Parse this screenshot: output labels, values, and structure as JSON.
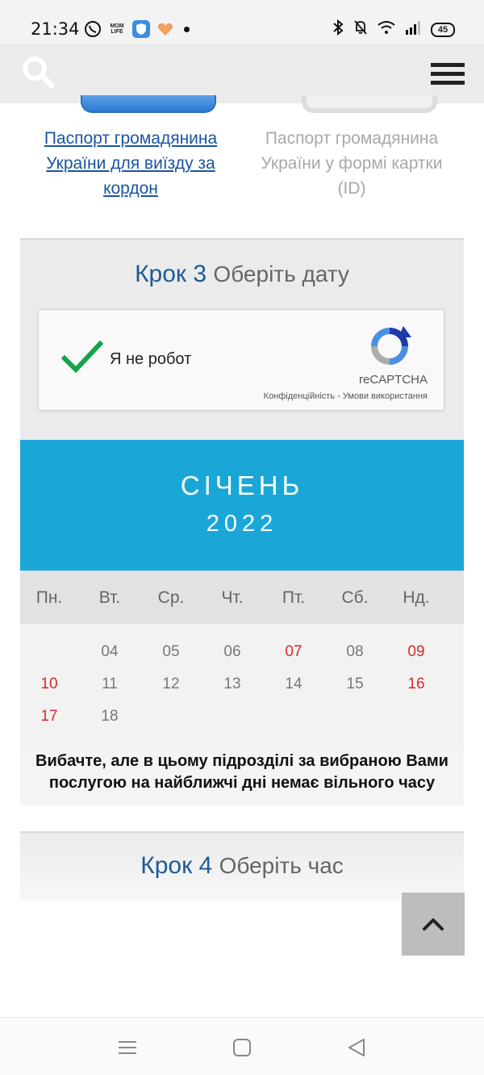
{
  "status_bar": {
    "time": "21:34",
    "app_icons": [
      "viber-icon",
      "mom-life-icon",
      "shield-app-icon",
      "health-heart-icon"
    ],
    "mom_life_label": "MOM LIFE",
    "battery": "45"
  },
  "passports": {
    "item1_label": "Паспорт громадянина України для виїзду за кордон",
    "item2_label": "Паспорт громадянина України у формі картки (ID)"
  },
  "step3": {
    "number": "Крок 3",
    "description": "Оберіть дату"
  },
  "recaptcha": {
    "label": "Я не робот",
    "brand": "reCAPTCHA",
    "privacy": "Конфіденційність",
    "separator": " - ",
    "terms": "Умови використання"
  },
  "calendar": {
    "month": "СІЧЕНЬ",
    "year": "2022",
    "weekdays": [
      "Пн.",
      "Вт.",
      "Ср.",
      "Чт.",
      "Пт.",
      "Сб.",
      "Нд."
    ],
    "weeks": [
      [
        "",
        "04",
        "05",
        "06",
        "07",
        "08",
        "09"
      ],
      [
        "10",
        "11",
        "12",
        "13",
        "14",
        "15",
        "16"
      ],
      [
        "17",
        "18",
        "",
        "",
        "",
        "",
        ""
      ]
    ],
    "highlight_days": [
      "07",
      "09",
      "10",
      "16",
      "17"
    ],
    "header_color": "#1aa7d8",
    "highlight_color": "#d52b2b"
  },
  "message": "Вибачте, але в цьому підрозділі за вибраною Вами послугою на найближчі дні немає вільного часу",
  "step4": {
    "number": "Крок 4",
    "description": "Оберіть час"
  },
  "icons": {
    "search": "search-icon",
    "menu": "hamburger-menu-icon",
    "scroll_top": "chevron-up-icon"
  }
}
